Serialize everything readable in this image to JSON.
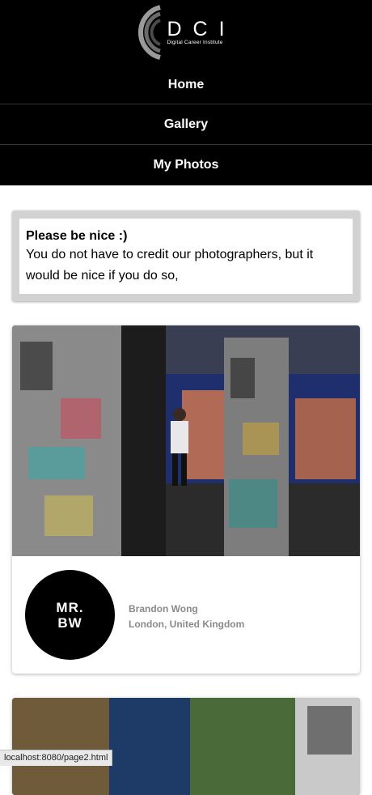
{
  "header": {
    "logo_letters": "DCI",
    "logo_subtitle": "Digital Career Institute",
    "nav": [
      {
        "label": "Home"
      },
      {
        "label": "Gallery"
      },
      {
        "label": "My Photos"
      }
    ]
  },
  "notice": {
    "title": "Please be nice :)",
    "body": "You do not have to credit our photographers, but it would be nice if you do so,"
  },
  "cards": [
    {
      "avatar_line1": "MR.",
      "avatar_line2": "BW",
      "author_name": "Brandon Wong",
      "author_location": "London, United Kingdom"
    }
  ],
  "status_bar": {
    "url": "localhost:8080/page2.html"
  },
  "colors": {
    "header_bg": "#000000",
    "notice_frame": "#d2d2d2",
    "author_text": "#8a8a8a"
  }
}
